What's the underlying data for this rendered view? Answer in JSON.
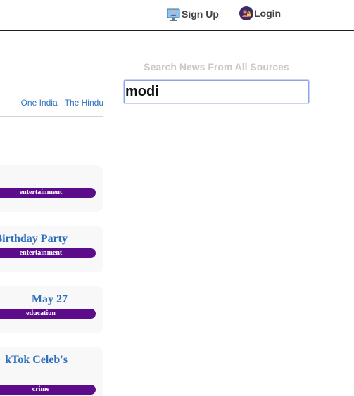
{
  "header": {
    "signup_label": "Sign Up",
    "login_label": "Login",
    "signup_icon": "monitor-user-icon",
    "login_icon": "lock-user-icon"
  },
  "search": {
    "title": "Search News From All Sources",
    "value": "modi"
  },
  "sources": [
    "One India",
    "The Hindu"
  ],
  "cards": [
    {
      "title": "",
      "tag": "entertainment"
    },
    {
      "title": "Birthday Party",
      "tag": "entertainment"
    },
    {
      "title": "May 27",
      "tag": "education"
    },
    {
      "title": "kTok Celeb's",
      "tag": "crime"
    }
  ],
  "colors": {
    "tag_bg": "#5c0b8a",
    "link": "#2f6fbd",
    "input_border": "#8fa3ea"
  }
}
